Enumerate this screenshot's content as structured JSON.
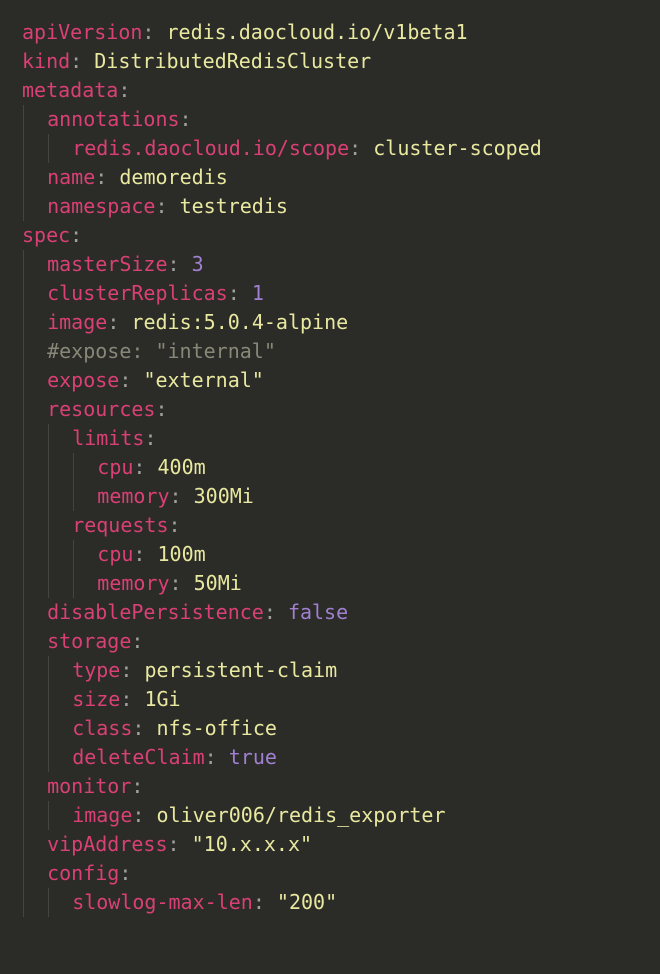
{
  "lines": {
    "l1": {
      "key": "apiVersion",
      "val": "redis.daocloud.io/v1beta1",
      "type": "str"
    },
    "l2": {
      "key": "kind",
      "val": "DistributedRedisCluster",
      "type": "str"
    },
    "l3": {
      "key": "metadata",
      "val": "",
      "type": "none"
    },
    "l4": {
      "key": "annotations",
      "val": "",
      "type": "none"
    },
    "l5": {
      "key": "redis.daocloud.io/scope",
      "val": "cluster-scoped",
      "type": "str"
    },
    "l6": {
      "key": "name",
      "val": "demoredis",
      "type": "str"
    },
    "l7": {
      "key": "namespace",
      "val": "testredis",
      "type": "str"
    },
    "l8": {
      "key": "spec",
      "val": "",
      "type": "none"
    },
    "l9": {
      "key": "masterSize",
      "val": "3",
      "type": "num"
    },
    "l10": {
      "key": "clusterReplicas",
      "val": "1",
      "type": "num"
    },
    "l11": {
      "key": "image",
      "val": "redis:5.0.4-alpine",
      "type": "str"
    },
    "l12": {
      "comment": "#expose: \"internal\"",
      "type": "comment"
    },
    "l13": {
      "key": "expose",
      "val": "\"external\"",
      "type": "str"
    },
    "l14": {
      "key": "resources",
      "val": "",
      "type": "none"
    },
    "l15": {
      "key": "limits",
      "val": "",
      "type": "none"
    },
    "l16": {
      "key": "cpu",
      "val": "400m",
      "type": "str"
    },
    "l17": {
      "key": "memory",
      "val": "300Mi",
      "type": "str"
    },
    "l18": {
      "key": "requests",
      "val": "",
      "type": "none"
    },
    "l19": {
      "key": "cpu",
      "val": "100m",
      "type": "str"
    },
    "l20": {
      "key": "memory",
      "val": "50Mi",
      "type": "str"
    },
    "l21": {
      "key": "disablePersistence",
      "val": "false",
      "type": "bool"
    },
    "l22": {
      "key": "storage",
      "val": "",
      "type": "none"
    },
    "l23": {
      "key": "type",
      "val": "persistent-claim",
      "type": "str"
    },
    "l24": {
      "key": "size",
      "val": "1Gi",
      "type": "str"
    },
    "l25": {
      "key": "class",
      "val": "nfs-office",
      "type": "str"
    },
    "l26": {
      "key": "deleteClaim",
      "val": "true",
      "type": "bool"
    },
    "l27": {
      "key": "monitor",
      "val": "",
      "type": "none"
    },
    "l28": {
      "key": "image",
      "val": "oliver006/redis_exporter",
      "type": "str"
    },
    "l29": {
      "key": "vipAddress",
      "val": "\"10.x.x.x\"",
      "type": "str"
    },
    "l30": {
      "key": "config",
      "val": "",
      "type": "none"
    },
    "l31": {
      "key": "slowlog-max-len",
      "val": "\"200\"",
      "type": "str"
    }
  }
}
